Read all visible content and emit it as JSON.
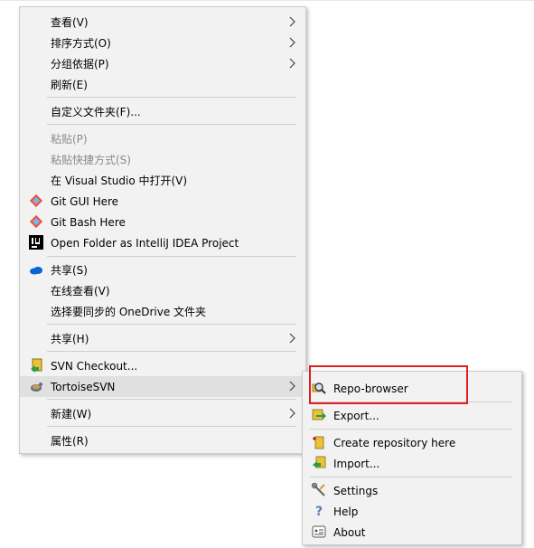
{
  "context_menu": {
    "items": [
      {
        "label": "查看(V)"
      },
      {
        "label": "排序方式(O)"
      },
      {
        "label": "分组依据(P)"
      },
      {
        "label": "刷新(E)"
      },
      {
        "label": "自定义文件夹(F)..."
      },
      {
        "label": "粘贴(P)"
      },
      {
        "label": "粘贴快捷方式(S)"
      },
      {
        "label": "在 Visual Studio 中打开(V)"
      },
      {
        "label": "Git GUI Here"
      },
      {
        "label": "Git Bash Here"
      },
      {
        "label": "Open Folder as IntelliJ IDEA Project"
      },
      {
        "label": "共享(S)"
      },
      {
        "label": "在线查看(V)"
      },
      {
        "label": "选择要同步的 OneDrive 文件夹"
      },
      {
        "label": "共享(H)"
      },
      {
        "label": "SVN Checkout..."
      },
      {
        "label": "TortoiseSVN"
      },
      {
        "label": "新建(W)"
      },
      {
        "label": "属性(R)"
      }
    ]
  },
  "tortoise_submenu": {
    "items": [
      {
        "label": "Repo-browser"
      },
      {
        "label": "Export..."
      },
      {
        "label": "Create repository here"
      },
      {
        "label": "Import..."
      },
      {
        "label": "Settings"
      },
      {
        "label": "Help"
      },
      {
        "label": "About"
      }
    ]
  },
  "colors": {
    "menu_background": "#f2f2f2",
    "hover_background": "#e0e0e0",
    "highlight_box": "#e02020",
    "disabled_text": "#8a8a8a"
  }
}
